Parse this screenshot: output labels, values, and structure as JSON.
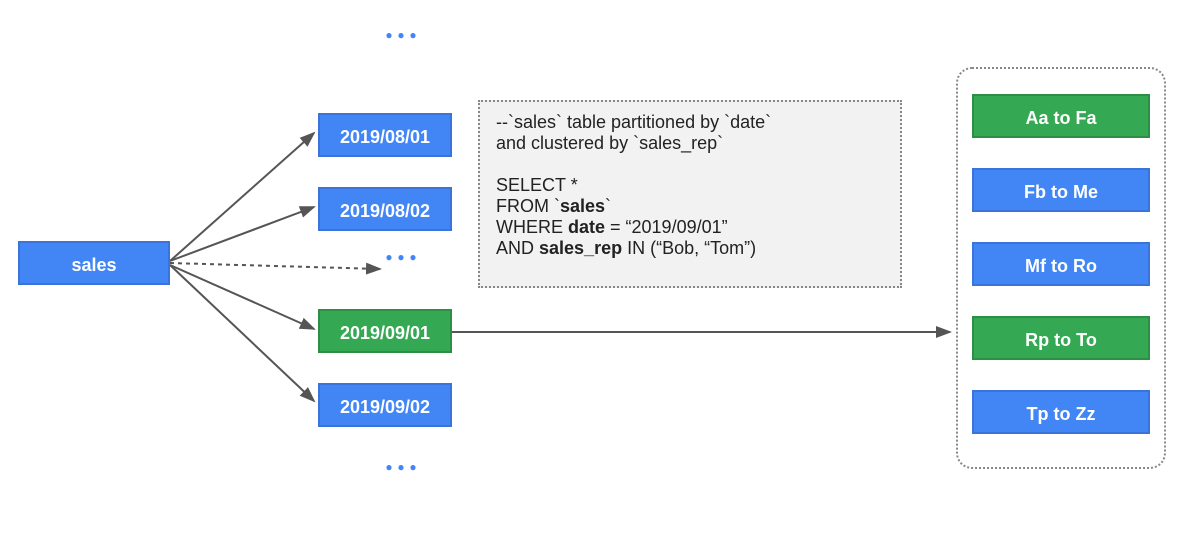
{
  "diagram": {
    "source_table": "sales",
    "partitions": [
      {
        "label": "2019/08/01",
        "color": "blue"
      },
      {
        "label": "2019/08/02",
        "color": "blue"
      },
      {
        "label": "2019/09/01",
        "color": "green"
      },
      {
        "label": "2019/09/02",
        "color": "blue"
      }
    ],
    "clusters": [
      {
        "label": "Aa to Fa",
        "color": "green"
      },
      {
        "label": "Fb to Me",
        "color": "blue"
      },
      {
        "label": "Mf to Ro",
        "color": "blue"
      },
      {
        "label": "Rp to To",
        "color": "green"
      },
      {
        "label": "Tp to Zz",
        "color": "blue"
      }
    ],
    "code": {
      "comment1": "--`sales` table partitioned by `date`",
      "comment2": "and clustered by `sales_rep`",
      "blank": " ",
      "select": "SELECT *",
      "from_prefix": "FROM `",
      "from_table": "sales",
      "from_suffix": "`",
      "where_prefix": "WHERE ",
      "where_field": "date",
      "where_suffix": " = “2019/09/01”",
      "and_prefix": "AND ",
      "and_field": "sales_rep",
      "and_suffix": " IN (“Bob, “Tom”)"
    },
    "colors": {
      "blue": "#4285f4",
      "green": "#34a853",
      "arrow": "#555555"
    }
  }
}
